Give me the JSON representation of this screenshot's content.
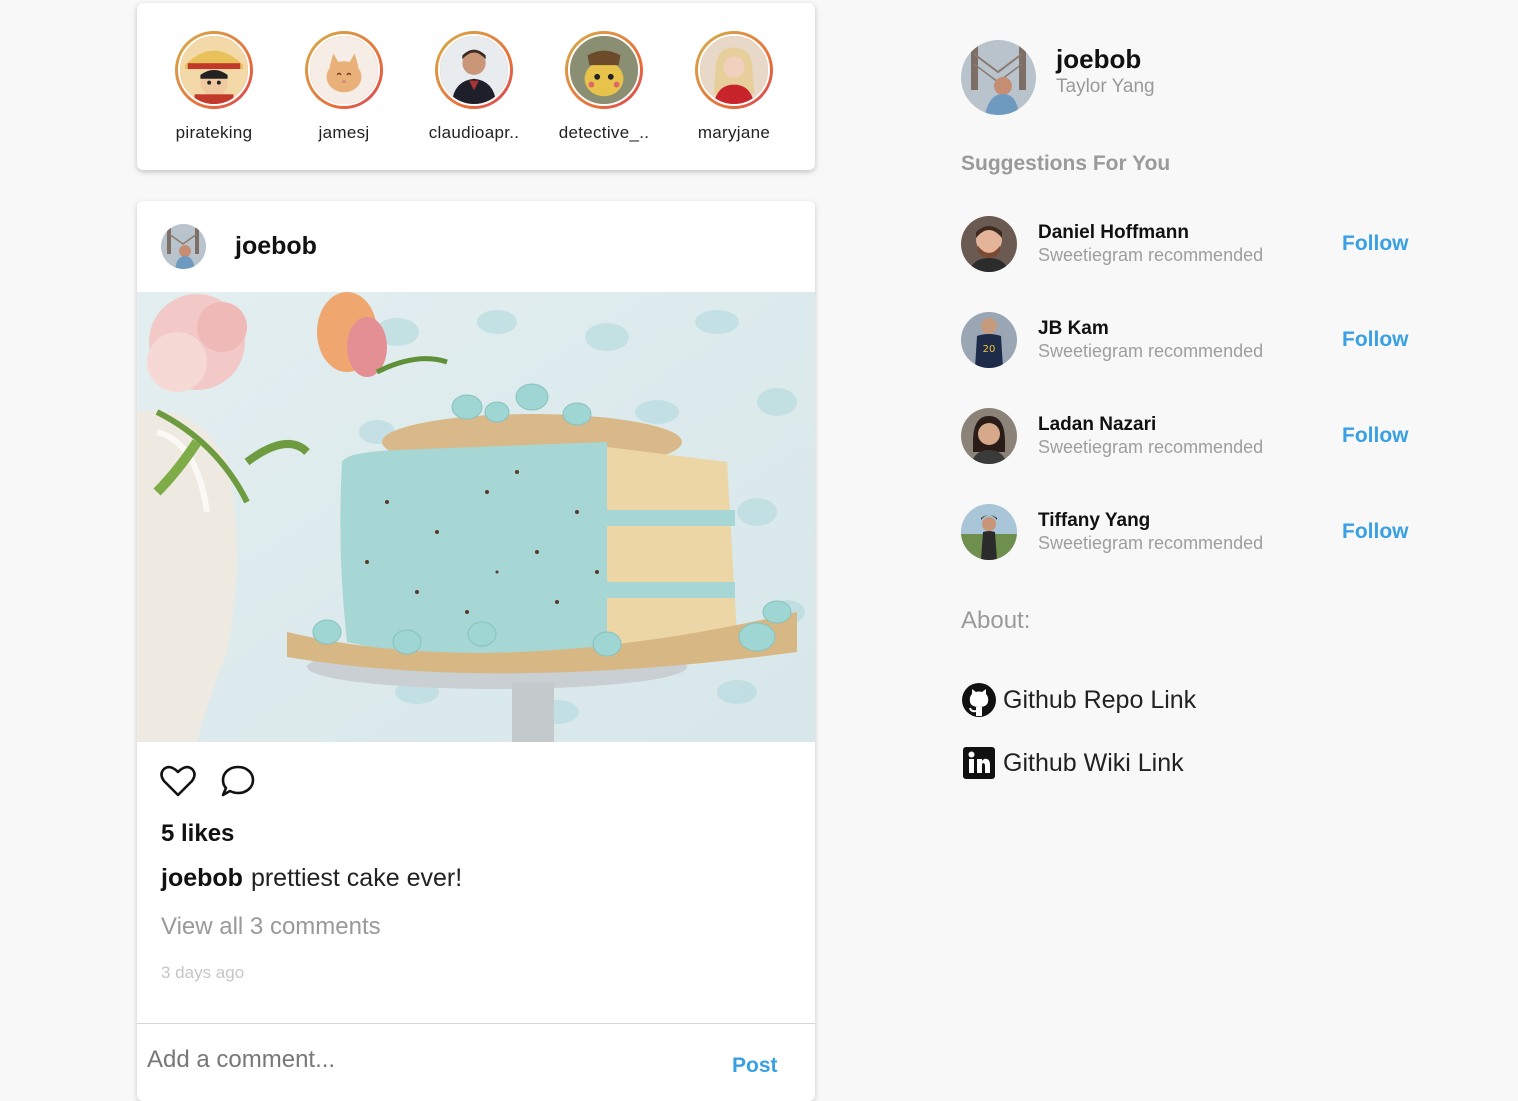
{
  "stories": [
    {
      "username": "pirateking"
    },
    {
      "username": "jamesj"
    },
    {
      "username": "claudioapr.."
    },
    {
      "username": "detective_.."
    },
    {
      "username": "maryjane"
    }
  ],
  "post": {
    "username": "joebob",
    "likes_text": "5 likes",
    "caption_user": "joebob",
    "caption_text": "prettiest cake ever!",
    "view_comments": "View all 3 comments",
    "time_ago": "3 days ago",
    "comment_placeholder": "Add a comment...",
    "post_button": "Post"
  },
  "profile": {
    "username": "joebob",
    "full_name": "Taylor Yang"
  },
  "suggestions": {
    "title": "Suggestions For You",
    "items": [
      {
        "name": "Daniel Hoffmann",
        "subtitle": "Sweetiegram recommended",
        "action": "Follow"
      },
      {
        "name": "JB Kam",
        "subtitle": "Sweetiegram recommended",
        "action": "Follow"
      },
      {
        "name": "Ladan Nazari",
        "subtitle": "Sweetiegram recommended",
        "action": "Follow"
      },
      {
        "name": "Tiffany Yang",
        "subtitle": "Sweetiegram recommended",
        "action": "Follow"
      }
    ]
  },
  "about": {
    "title": "About:",
    "links": [
      {
        "label": "Github Repo Link",
        "icon": "github-icon"
      },
      {
        "label": "Github Wiki Link",
        "icon": "linkedin-icon"
      }
    ]
  },
  "colors": {
    "accent": "#3aa0e4",
    "background": "#f8f8f8",
    "muted": "#9a9a9a"
  }
}
